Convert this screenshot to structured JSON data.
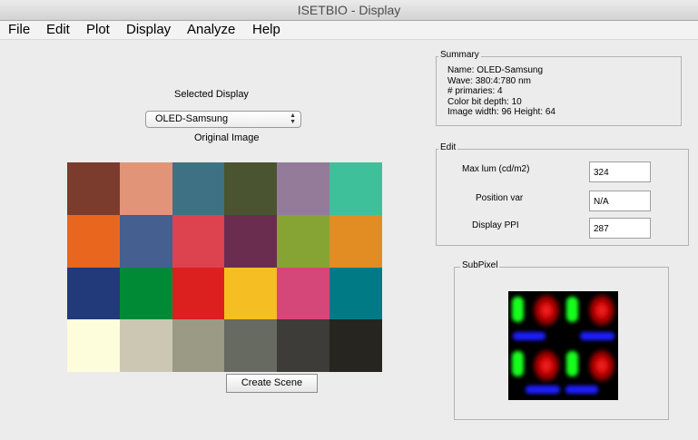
{
  "window": {
    "title": "ISETBIO - Display"
  },
  "menu": [
    "File",
    "Edit",
    "Plot",
    "Display",
    "Analyze",
    "Help"
  ],
  "selected_display": {
    "label": "Selected Display",
    "value": "OLED-Samsung"
  },
  "original_image": {
    "label": "Original Image",
    "colors": [
      "#7b3c2e",
      "#e29478",
      "#3f7185",
      "#4a5430",
      "#947b99",
      "#3ec09a",
      "#e9661e",
      "#445f90",
      "#dc434f",
      "#6a2d50",
      "#86a433",
      "#e18d24",
      "#233a7a",
      "#018a36",
      "#dc1f1f",
      "#f5be22",
      "#d44778",
      "#007b86",
      "#fdfddb",
      "#ccc7b3",
      "#9a9a85",
      "#666a60",
      "#3d3c38",
      "#27251f"
    ]
  },
  "create_scene_button": "Create Scene",
  "summary": {
    "title": "Summary",
    "lines": [
      "Name: OLED-Samsung",
      "Wave: 380:4:780 nm",
      "# primaries: 4",
      "Color bit depth: 10",
      "Image width: 96  Height: 64"
    ]
  },
  "edit": {
    "title": "Edit",
    "max_lum_label": "Max lum (cd/m2)",
    "max_lum_value": "324",
    "position_var_label": "Position var",
    "position_var_value": "N/A",
    "display_ppi_label": "Display PPI",
    "display_ppi_value": "287"
  },
  "subpixel": {
    "title": "SubPixel"
  }
}
